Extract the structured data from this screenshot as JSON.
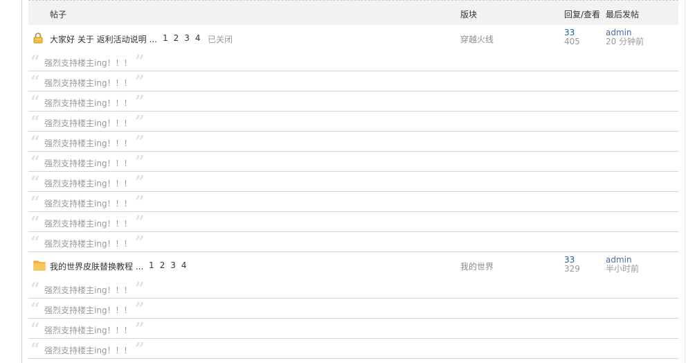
{
  "header": {
    "col_post": "帖子",
    "col_forum": "版块",
    "col_stats": "回复/查看",
    "col_last": "最后发帖"
  },
  "threads": [
    {
      "icon": "lock-icon",
      "title": "大家好 关于 返利活动说明 ...",
      "pages": [
        "1",
        "2",
        "3",
        "4"
      ],
      "status": "已关闭",
      "forum": "穿越火线",
      "replies": "33",
      "views": "405",
      "last_user": "admin",
      "last_time": "20 分钟前",
      "comments": [
        "强烈支持楼主ing！！！",
        "强烈支持楼主ing！！！",
        "强烈支持楼主ing！！！",
        "强烈支持楼主ing！！！",
        "强烈支持楼主ing！！！",
        "强烈支持楼主ing！！！",
        "强烈支持楼主ing！！！",
        "强烈支持楼主ing！！！",
        "强烈支持楼主ing！！！",
        "强烈支持楼主ing！！！"
      ]
    },
    {
      "icon": "folder-icon",
      "title": "我的世界皮肤替换教程 ...",
      "pages": [
        "1",
        "2",
        "3",
        "4"
      ],
      "status": "",
      "forum": "我的世界",
      "replies": "33",
      "views": "329",
      "last_user": "admin",
      "last_time": "半小时前",
      "comments": [
        "强烈支持楼主ing！！！",
        "强烈支持楼主ing！！！",
        "强烈支持楼主ing！！！",
        "强烈支持楼主ing！！！"
      ]
    }
  ],
  "colors": {
    "reply_divider": "#c7d8e6",
    "header_bg": "#f2f2f2",
    "folder": "#f5b935"
  }
}
